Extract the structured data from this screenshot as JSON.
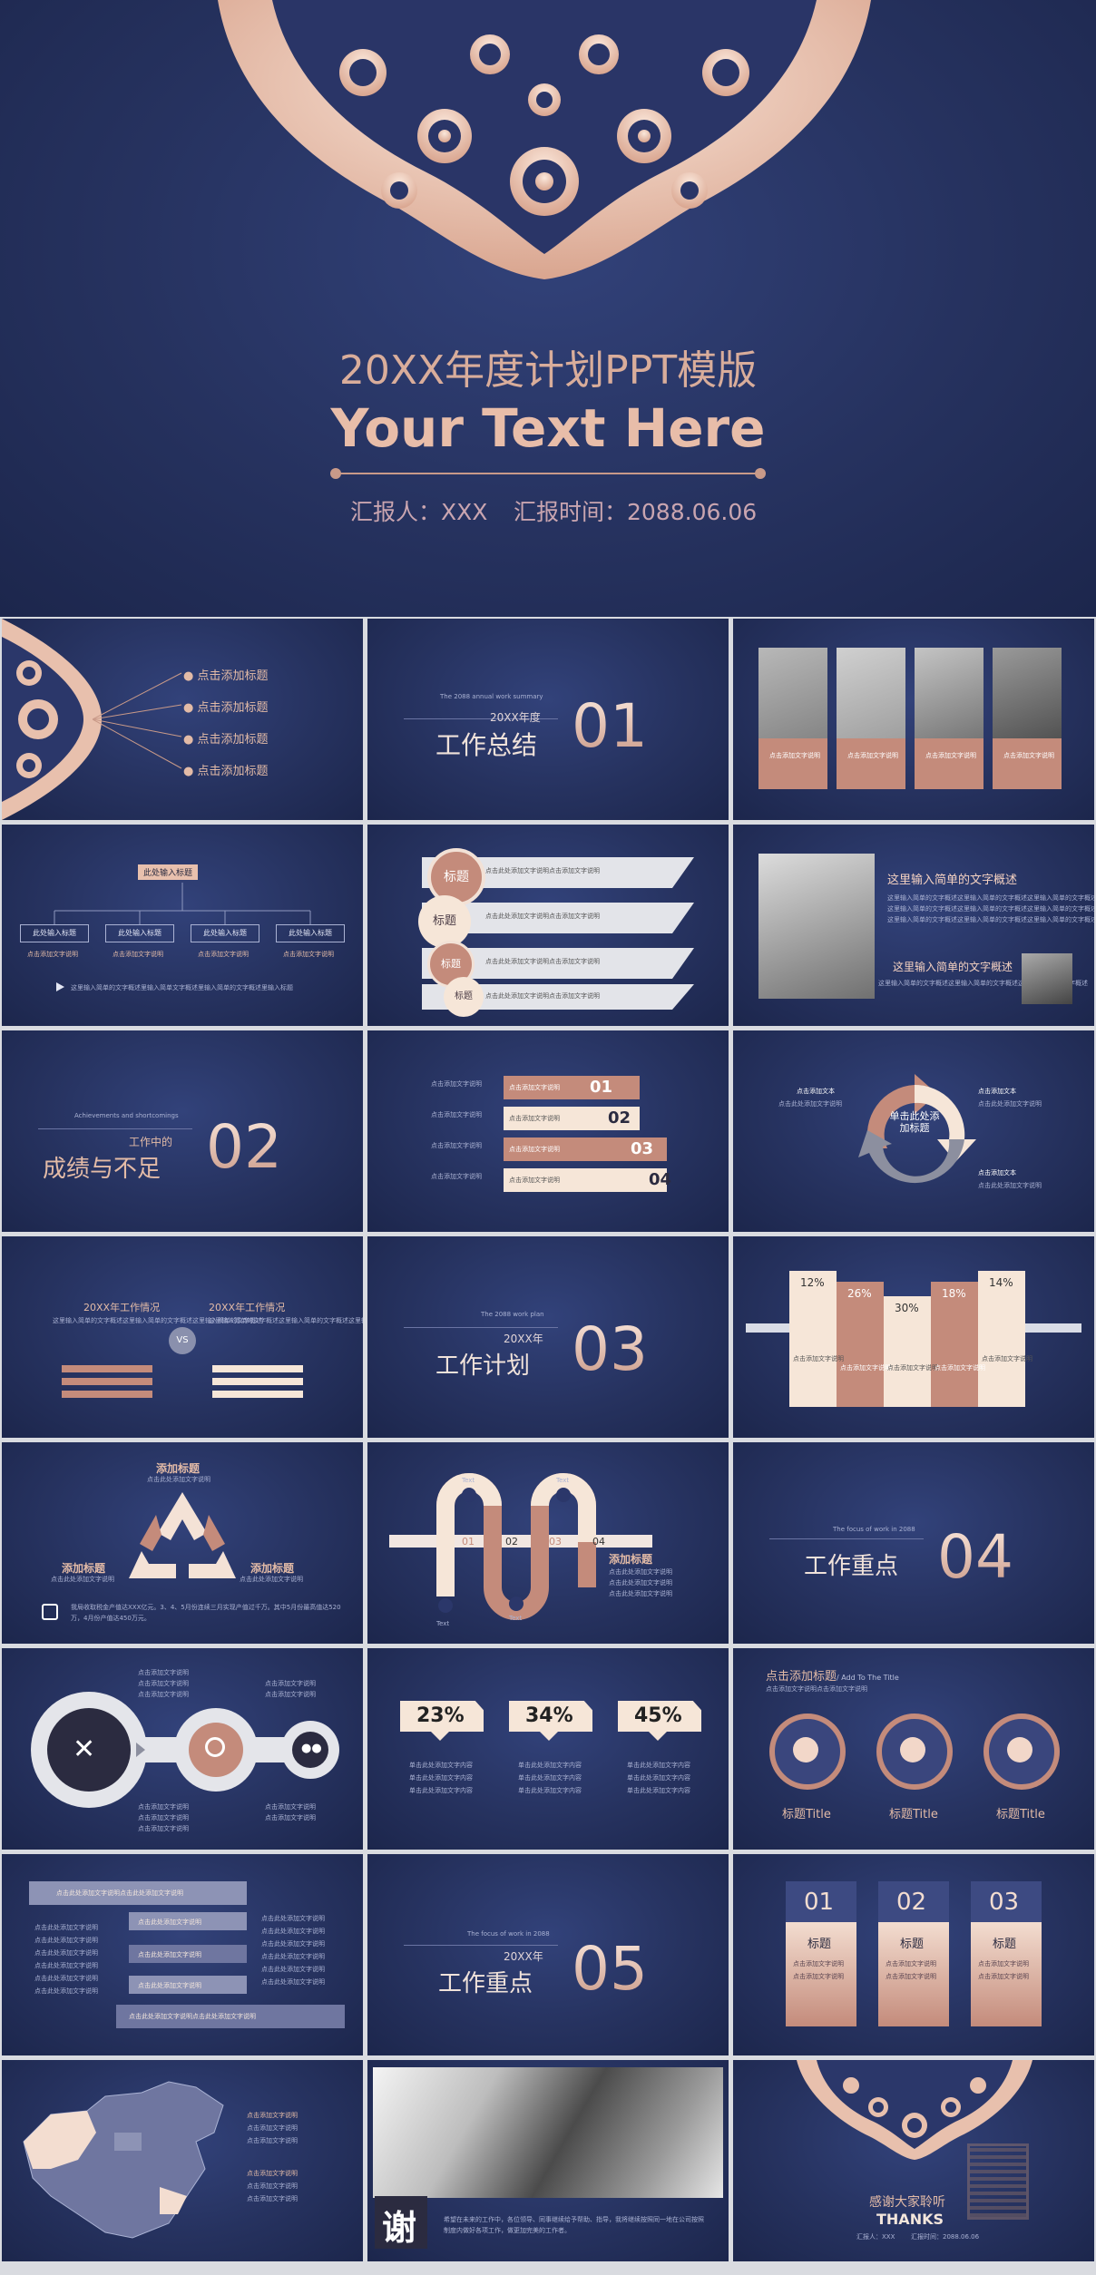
{
  "hero": {
    "title_cn": "20XX年度计划PPT模版",
    "title_en": "Your Text Here",
    "reporter_label": "汇报人：XXX",
    "time_label": "汇报时间：2088.06.06"
  },
  "s_toc": {
    "items": [
      "点击添加标题",
      "点击添加标题",
      "点击添加标题",
      "点击添加标题"
    ]
  },
  "s_sec1": {
    "eyebrow": "The 2088 annual work summary",
    "sub": "20XX年度",
    "title": "工作总结",
    "num": "01"
  },
  "s_photos": {
    "caption": "点击添加文字说明"
  },
  "s_org": {
    "top": "此处输入标题",
    "boxes": [
      "此处输入标题",
      "此处输入标题",
      "此处输入标题",
      "此处输入标题"
    ],
    "desc": "点击添加文字说明",
    "footer": "这里输入简单的文字概述里输入简单文字概述里输入简单的文字概述里输入标题"
  },
  "s_bubbles": {
    "labels": [
      "标题",
      "标题",
      "标题",
      "标题"
    ],
    "line": "点击此处添加文字说明点击添加文字说明"
  },
  "s_photo_text": {
    "h1": "这里输入简单的文字概述",
    "h2": "这里输入简单的文字概述",
    "body": "这里输入简单的文字概述这里输入简单的文字概述这里输入简单的文字概述"
  },
  "s_sec2": {
    "eyebrow": "Achievements and shortcomings",
    "sub": "工作中的",
    "title": "成绩与不足",
    "num": "02"
  },
  "s_steps": {
    "nums": [
      "01",
      "02",
      "03",
      "04"
    ],
    "line": "点击添加文字说明"
  },
  "s_cycle": {
    "center": "单击此处添加标题",
    "item": "点击添加文本",
    "desc": "点击此处添加文字说明"
  },
  "s_vs": {
    "left_title": "20XX年工作情况",
    "right_title": "20XX年工作情况",
    "vs": "VS",
    "body": "这里输入简单的文字概述这里输入简单的文字概述这里输入简单的文字概述"
  },
  "s_sec3": {
    "eyebrow": "The 2088 work plan",
    "sub": "20XX年",
    "title": "工作计划",
    "num": "03"
  },
  "s_bars": {
    "pcts": [
      "12%",
      "26%",
      "30%",
      "18%",
      "14%"
    ],
    "line": "点击添加文字说明"
  },
  "s_recycle": {
    "top": "添加标题",
    "left": "添加标题",
    "right": "添加标题",
    "sub": "点击此处添加文字说明",
    "foot": "我局收取税金产值达XXX亿元。3、4、5月份连续三月实现产值过千万。其中5月份最高值达520万，4月份产值达450万元。"
  },
  "s_wave": {
    "nums": [
      "01",
      "02",
      "03",
      "04"
    ],
    "text": "Text",
    "title": "添加标题",
    "line": "点击此处添加文字说明"
  },
  "s_sec4": {
    "eyebrow": "The focus of work in 2088",
    "title": "工作重点",
    "num": "04"
  },
  "s_icons": {
    "line": "点击添加文字说明"
  },
  "s_pcts": {
    "values": [
      "23%",
      "34%",
      "45%"
    ],
    "line": "单击此处添加文字内容"
  },
  "s_circles": {
    "title": "点击添加标题",
    "add": "/ Add To The Title",
    "desc": "点击添加文字说明点击添加文字说明",
    "labels": [
      "标题Title",
      "标题Title",
      "标题Title"
    ]
  },
  "s_layers": {
    "top": "点击此处添加文字说明点击此处添加文字说明",
    "line": "点击此处添加文字说明",
    "bottom": "点击此处添加文字说明点击此处添加文字说明"
  },
  "s_sec5": {
    "eyebrow": "The focus of work in 2088",
    "sub": "20XX年",
    "title": "工作重点",
    "num": "05"
  },
  "s_cards": {
    "nums": [
      "01",
      "02",
      "03"
    ],
    "label": "标题",
    "line": "点击添加文字说明"
  },
  "s_map": {
    "line": "点击添加文字说明"
  },
  "s_thanks_photo": {
    "char": "谢",
    "body": "希望在未来的工作中，各位领导、同事继续给予帮助、指导，我将继续按照同一地在公司按照制度内做好各项工作，做更加完美的工作者。"
  },
  "s_end": {
    "cn": "感谢大家聆听",
    "en": "THANKS",
    "reporter": "汇报人：XXX",
    "time": "汇报时间：2088.06.06"
  },
  "colors": {
    "navy": "#26325f",
    "rose": "#c48b7b",
    "cream": "#f6e6d8",
    "gray": "#e4e5ea"
  }
}
